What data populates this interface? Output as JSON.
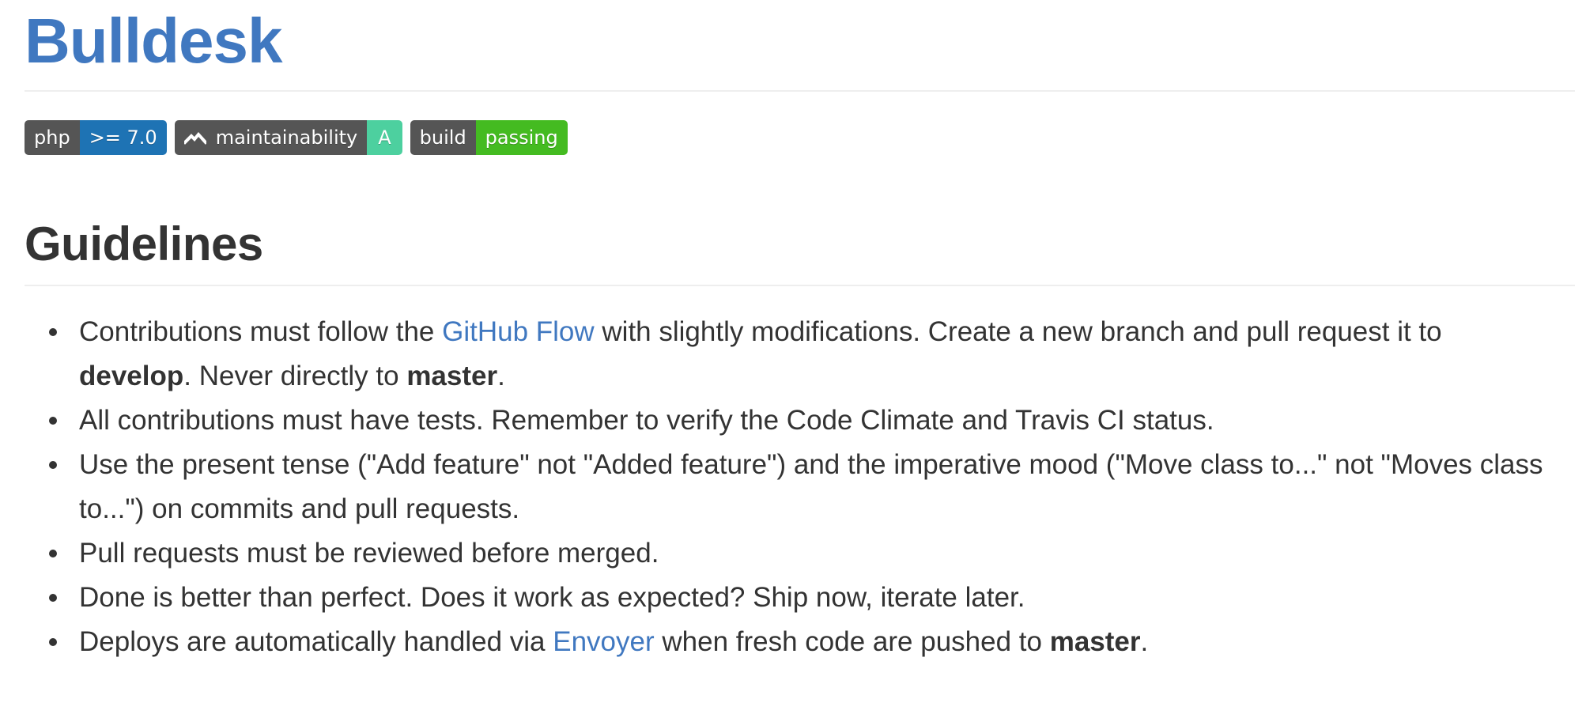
{
  "title": "Bulldesk",
  "badges": {
    "php": {
      "label": "php",
      "value": ">= 7.0",
      "value_color": "#1e73b4"
    },
    "maintainability": {
      "icon": "codeclimate-icon",
      "label": "maintainability",
      "value": "A",
      "value_color": "#4dd09f"
    },
    "build": {
      "label": "build",
      "value": "passing",
      "value_color": "#44bb21"
    }
  },
  "guidelines": {
    "heading": "Guidelines",
    "items": [
      {
        "t1": "Contributions must follow the ",
        "link": "GitHub Flow",
        "t2": " with slightly modifications. Create a new branch and pull request it to ",
        "b1": "develop",
        "t3": ". Never directly to ",
        "b2": "master",
        "t4": "."
      },
      {
        "text": "All contributions must have tests. Remember to verify the Code Climate and Travis CI status."
      },
      {
        "text": "Use the present tense (\"Add feature\" not \"Added feature\") and the imperative mood (\"Move class to...\" not \"Moves class to...\") on commits and pull requests."
      },
      {
        "text": "Pull requests must be reviewed before merged."
      },
      {
        "text": "Done is better than perfect. Does it work as expected? Ship now, iterate later."
      },
      {
        "t1": "Deploys are automatically handled via ",
        "link": "Envoyer",
        "t2": " when fresh code are pushed to ",
        "b1": "master",
        "t3": "."
      }
    ]
  },
  "colors": {
    "link": "#4078c0",
    "text": "#333333",
    "badge_label_bg": "#555555"
  }
}
